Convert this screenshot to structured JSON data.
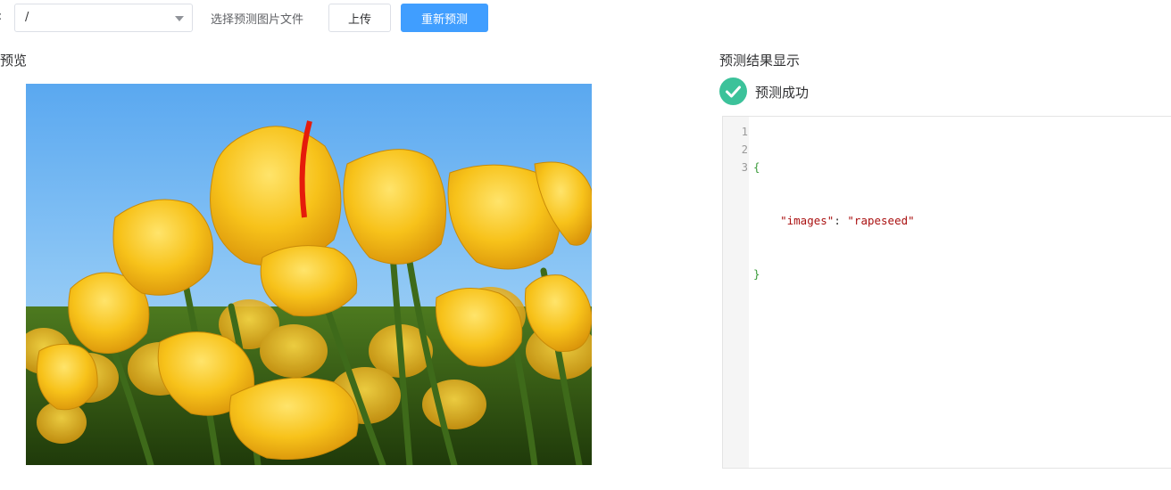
{
  "toolbar": {
    "stub_label": ":",
    "path_select_value": "/",
    "file_label": "选择预测图片文件",
    "upload_label": "上传",
    "repredict_label": "重新预测"
  },
  "preview": {
    "title": "预览",
    "image_subject": "yellow tulips against blue sky"
  },
  "result": {
    "title": "预测结果显示",
    "status_text": "预测成功",
    "status_icon": "check-circle-icon",
    "status_color": "#3cc29a",
    "line_numbers": [
      "1",
      "2",
      "3"
    ],
    "code_open": "{",
    "code_key": "\"images\"",
    "code_sep": ": ",
    "code_value": "\"rapeseed\"",
    "code_close": "}"
  },
  "colors": {
    "primary": "#409eff",
    "success": "#3cc29a",
    "json_brace": "#3a9b3a",
    "json_string": "#aa1111"
  }
}
